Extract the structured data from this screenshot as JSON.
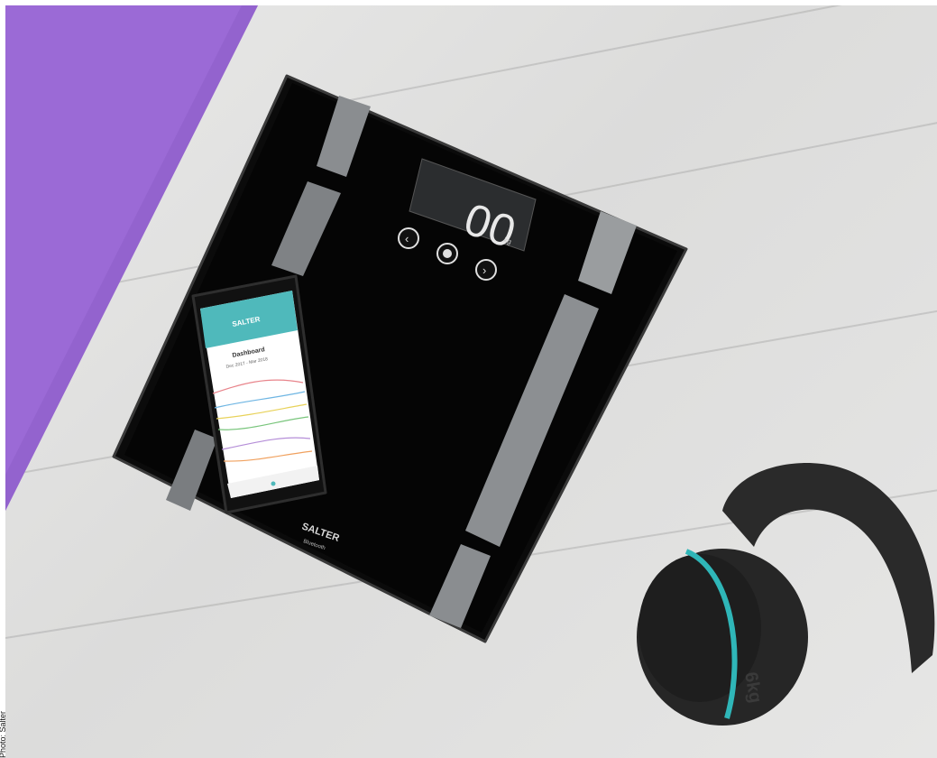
{
  "photo_credit": "Photo: Salter",
  "scale": {
    "brand": "SALTER",
    "sub_brand": "Bluetooth",
    "display_value": "00",
    "display_unit": "kg"
  },
  "phone_app": {
    "brand": "SALTER",
    "screen_title": "Dashboard",
    "date_range": "Dec 2017 - Mar 2018"
  },
  "kettlebell": {
    "weight_label": "6kg"
  },
  "colors": {
    "mat": "#9b6ad6",
    "floor": "#e2e2e1",
    "scale_glass": "#0a0a0a",
    "electrode": "#8a8d90",
    "kettlebell": "#2a2a2a",
    "kettlebell_band": "#2fb6b8"
  }
}
